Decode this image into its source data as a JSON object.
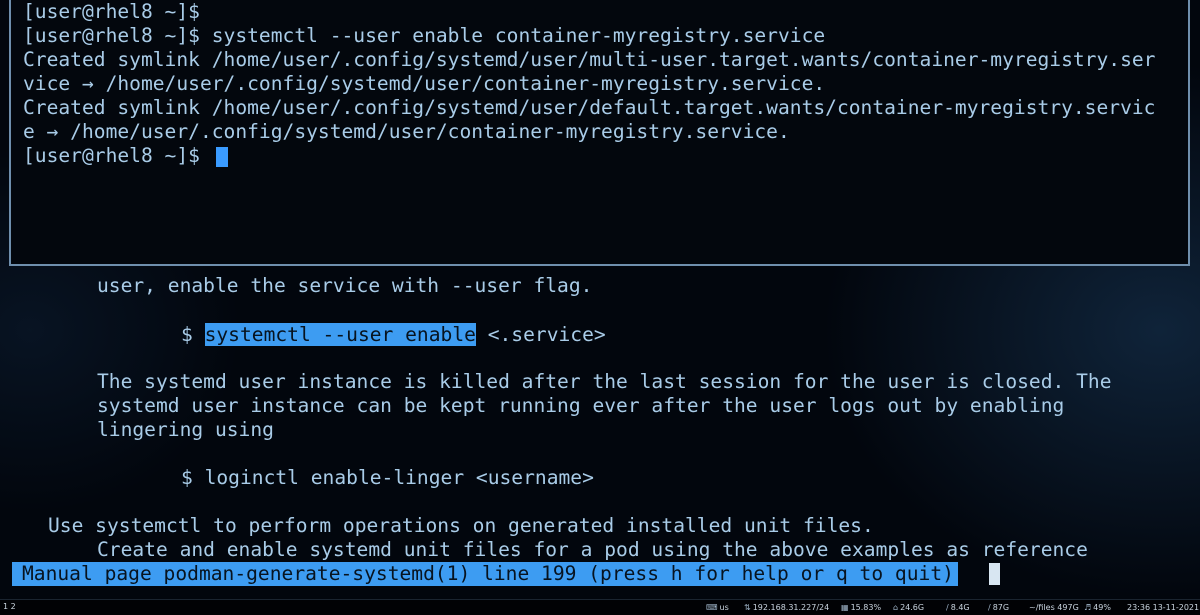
{
  "top_terminal": {
    "lines": [
      "[user@rhel8 ~]$",
      "[user@rhel8 ~]$ systemctl --user enable container-myregistry.service",
      "Created symlink /home/user/.config/systemd/user/multi-user.target.wants/container-myregistry.ser",
      "vice → /home/user/.config/systemd/user/container-myregistry.service.",
      "Created symlink /home/user/.config/systemd/user/default.target.wants/container-myregistry.servic",
      "e → /home/user/.config/systemd/user/container-myregistry.service.",
      "[user@rhel8 ~]$"
    ]
  },
  "man_page": {
    "line_1": "user, enable the service with --user flag.",
    "cmd1_prompt": "$ ",
    "cmd1_highlight": "systemctl --user enable",
    "cmd1_rest": " <.service>",
    "para_1": "The systemd user instance is killed after the last session for the user is closed. The",
    "para_2": "systemd user instance can be kept running ever after the user logs out by enabling",
    "para_3": "lingering using",
    "cmd2": "$ loginctl enable-linger <username>",
    "heading_line": "Use systemctl to perform operations on generated installed unit files.",
    "last_line": "Create and enable systemd unit files for a pod using the above examples as reference",
    "status_line": "Manual page podman-generate-systemd(1) line 199 (press h for help or q to quit)"
  },
  "status_bar": {
    "workspace": "1 2",
    "keyboard": "us",
    "ip": "192.168.31.227/24",
    "cpu": "15.83%",
    "disk_root": "24.6G",
    "disk_2": "8.4G",
    "disk_3": "87G",
    "disk_files": "~/files 497G",
    "volume": "49%",
    "datetime": "23:36 13-11-2021"
  },
  "colors": {
    "text": "#a9cce8",
    "highlight": "#3d9cf2",
    "cursor": "#3a9bff",
    "border": "#6f8fad",
    "background": "#02060d"
  }
}
